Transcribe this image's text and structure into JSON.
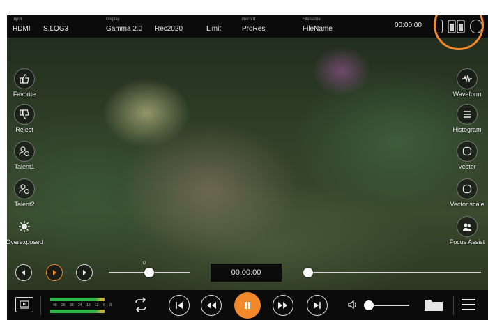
{
  "topbar": {
    "input": {
      "label": "Input",
      "source": "HDMI",
      "gamma": "S.LOG3"
    },
    "display": {
      "label": "Display",
      "gamma": "Gamma 2.0",
      "gamut": "Rec2020",
      "range": "Limit"
    },
    "record": {
      "label": "Record",
      "codec": "ProRes"
    },
    "filename": {
      "label": "FileName",
      "value": "FileName"
    },
    "timecode": "00:00:00"
  },
  "left_tools": [
    {
      "label": "Favorite",
      "icon": "thumbs-up-icon"
    },
    {
      "label": "Reject",
      "icon": "thumbs-down-icon"
    },
    {
      "label": "Talent1",
      "icon": "talent-icon"
    },
    {
      "label": "Talent2",
      "icon": "talent-icon"
    },
    {
      "label": "Overexposed",
      "icon": "overexposed-icon"
    }
  ],
  "right_tools": [
    {
      "label": "Waveform",
      "icon": "waveform-icon"
    },
    {
      "label": "Histogram",
      "icon": "histogram-icon"
    },
    {
      "label": "Vector",
      "icon": "vector-icon"
    },
    {
      "label": "Vector scale",
      "icon": "vector-scale-icon"
    },
    {
      "label": "Focus Assist",
      "icon": "focus-assist-icon"
    }
  ],
  "scrub": {
    "marker_value": "0",
    "timecode": "00:00:00",
    "left_progress": 0.5,
    "right_progress": 0.0
  },
  "audio_meter": {
    "scale": [
      "48",
      "36",
      "30",
      "24",
      "18",
      "12",
      "6",
      "0"
    ],
    "levels": [
      0.85,
      0.85
    ]
  },
  "volume": {
    "level": 0.1
  },
  "colors": {
    "accent": "#f28a2b",
    "bar": "#0b0b0b"
  }
}
